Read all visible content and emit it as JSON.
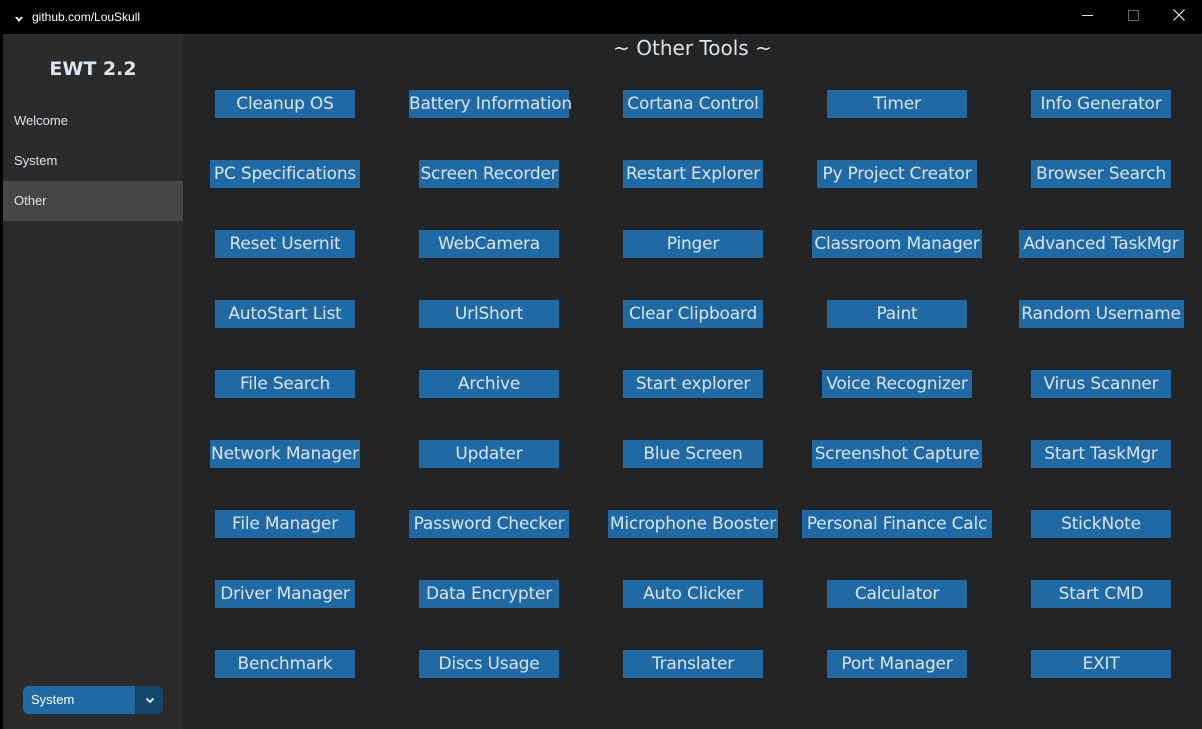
{
  "window": {
    "title": "github.com/LouSkull",
    "minimize_icon": "minimize-icon",
    "maximize_icon": "maximize-icon",
    "close_icon": "close-icon"
  },
  "sidebar": {
    "app_title": "EWT 2.2",
    "items": [
      {
        "label": "Welcome",
        "active": false
      },
      {
        "label": "System",
        "active": false
      },
      {
        "label": "Other",
        "active": true
      }
    ],
    "appearance_mode": {
      "value": "System",
      "icon": "chevron-down-icon"
    }
  },
  "main": {
    "title": "~ Other Tools ~",
    "tools": [
      [
        "Cleanup OS",
        "Battery Information",
        "Cortana Control",
        "Timer",
        "Info Generator"
      ],
      [
        "PC Specifications",
        "Screen Recorder",
        "Restart Explorer",
        "Py Project Creator",
        "Browser Search"
      ],
      [
        "Reset Usernit",
        "WebCamera",
        "Pinger",
        "Classroom Manager",
        "Advanced TaskMgr"
      ],
      [
        "AutoStart List",
        "UrlShort",
        "Clear Clipboard",
        "Paint",
        "Random Username"
      ],
      [
        "File Search",
        "Archive",
        "Start explorer",
        "Voice Recognizer",
        "Virus Scanner"
      ],
      [
        "Network Manager",
        "Updater",
        "Blue Screen",
        "Screenshot Capture",
        "Start TaskMgr"
      ],
      [
        "File Manager",
        "Password Checker",
        "Microphone Booster",
        "Personal Finance Calc",
        "StickNote"
      ],
      [
        "Driver Manager",
        "Data Encrypter",
        "Auto Clicker",
        "Calculator",
        "Start CMD"
      ],
      [
        "Benchmark",
        "Discs Usage",
        "Translater",
        "Port Manager",
        "EXIT"
      ]
    ]
  },
  "colors": {
    "accent": "#1f6aa5",
    "sidebar_bg": "#2b2b2b",
    "main_bg": "#242424",
    "active_nav": "#464646"
  }
}
